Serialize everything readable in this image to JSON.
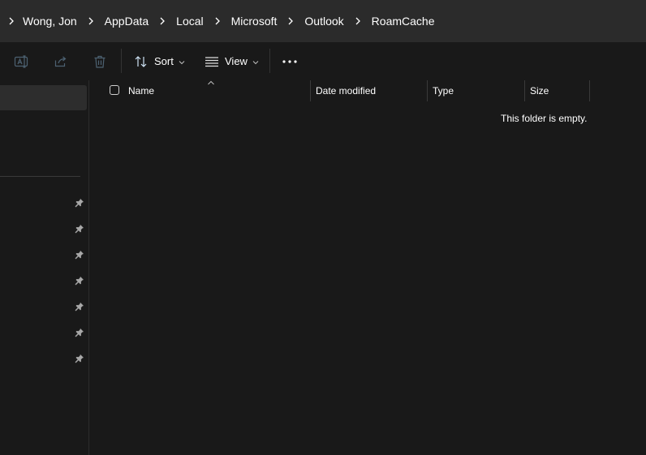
{
  "breadcrumb": {
    "items": [
      "Wong, Jon",
      "AppData",
      "Local",
      "Microsoft",
      "Outlook",
      "RoamCache"
    ]
  },
  "toolbar": {
    "sort_label": "Sort",
    "view_label": "View"
  },
  "columns": {
    "name": "Name",
    "date_modified": "Date modified",
    "type": "Type",
    "size": "Size"
  },
  "content": {
    "empty_message": "This folder is empty."
  },
  "colors": {
    "background": "#191919",
    "address_bar": "#2b2b2b",
    "nav_selected": "#2d2d2d",
    "accent_disabled": "#4d6272"
  }
}
